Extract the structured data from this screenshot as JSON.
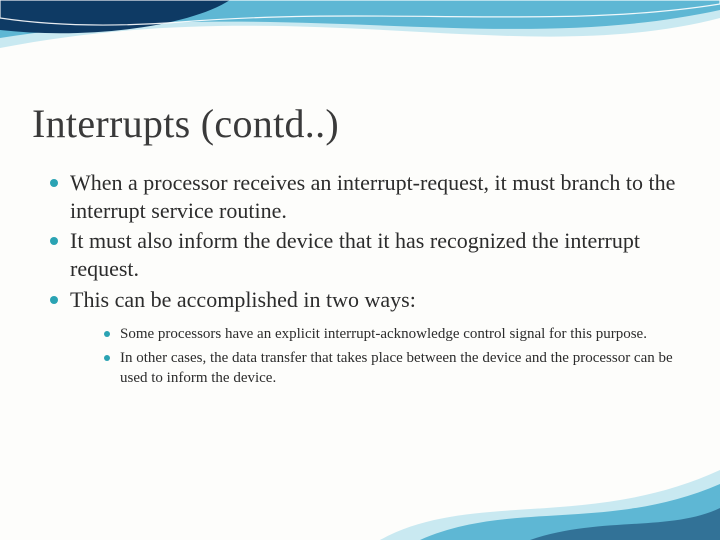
{
  "title": "Interrupts (contd..)",
  "bullets": [
    "When a processor receives an interrupt-request, it must branch to the interrupt service routine.",
    "It must also inform the device that it has recognized the interrupt request.",
    "This can be accomplished in two ways:"
  ],
  "sub_bullets": [
    "Some processors have an explicit interrupt-acknowledge control signal for this purpose.",
    "In other cases, the data transfer that takes place between the device and the processor can be used to inform the device."
  ],
  "colors": {
    "accent": "#2aa3b3",
    "wave_dark": "#0e3a64",
    "wave_mid": "#3aa6c9",
    "wave_light": "#bfe5ee"
  }
}
